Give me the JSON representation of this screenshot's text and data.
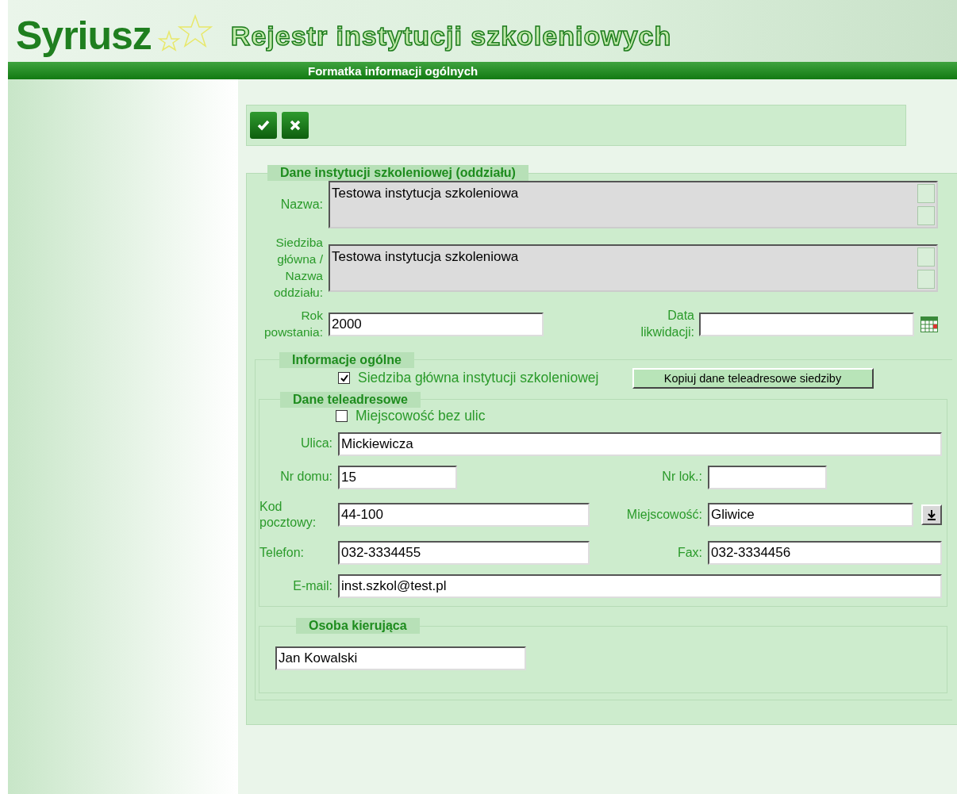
{
  "header": {
    "logo": "Syriusz",
    "app_title": "Rejestr instytucji szkoleniowych",
    "form_title": "Formatka informacji ogólnych"
  },
  "toolbar": [
    {
      "kind": "save"
    },
    {
      "kind": "cancel"
    }
  ],
  "institution": {
    "legend": "Dane instytucji szkoleniowej (oddziału)",
    "name": {
      "label": "Nazwa:",
      "value": "Testowa instytucja szkoleniowa"
    },
    "branch": {
      "label": "Siedziba główna / Nazwa oddziału:",
      "value": "Testowa instytucja szkoleniowa"
    },
    "founded": {
      "label": "Rok powstania:",
      "value": "2000"
    },
    "liquidation": {
      "label": "Data likwidacji:"
    }
  },
  "general": {
    "legend": "Informacje ogólne",
    "headquarters": {
      "label": "Siedziba główna instytucji szkoleniowej",
      "checked": true
    },
    "copy_button": "Kopiuj dane teleadresowe siedziby"
  },
  "contact": {
    "legend": "Dane teleadresowe",
    "no_streets": {
      "label": "Miejscowość bez ulic",
      "checked": false
    },
    "street": {
      "label": "Ulica:",
      "value": "Mickiewicza"
    },
    "house": {
      "label": "Nr domu:",
      "value": "15"
    },
    "flat": {
      "label": "Nr lok.:"
    },
    "postcode": {
      "label": "Kod pocztowy:",
      "value": "44-100"
    },
    "city": {
      "label": "Miejscowość:",
      "value": "Gliwice"
    },
    "phone": {
      "label": "Telefon:",
      "value": "032-3334455"
    },
    "fax": {
      "label": "Fax:",
      "value": "032-3334456"
    },
    "email": {
      "label": "E-mail:",
      "value": "inst.szkol@test.pl"
    }
  },
  "manager": {
    "legend": "Osoba kierująca",
    "value": "Jan Kowalski"
  }
}
